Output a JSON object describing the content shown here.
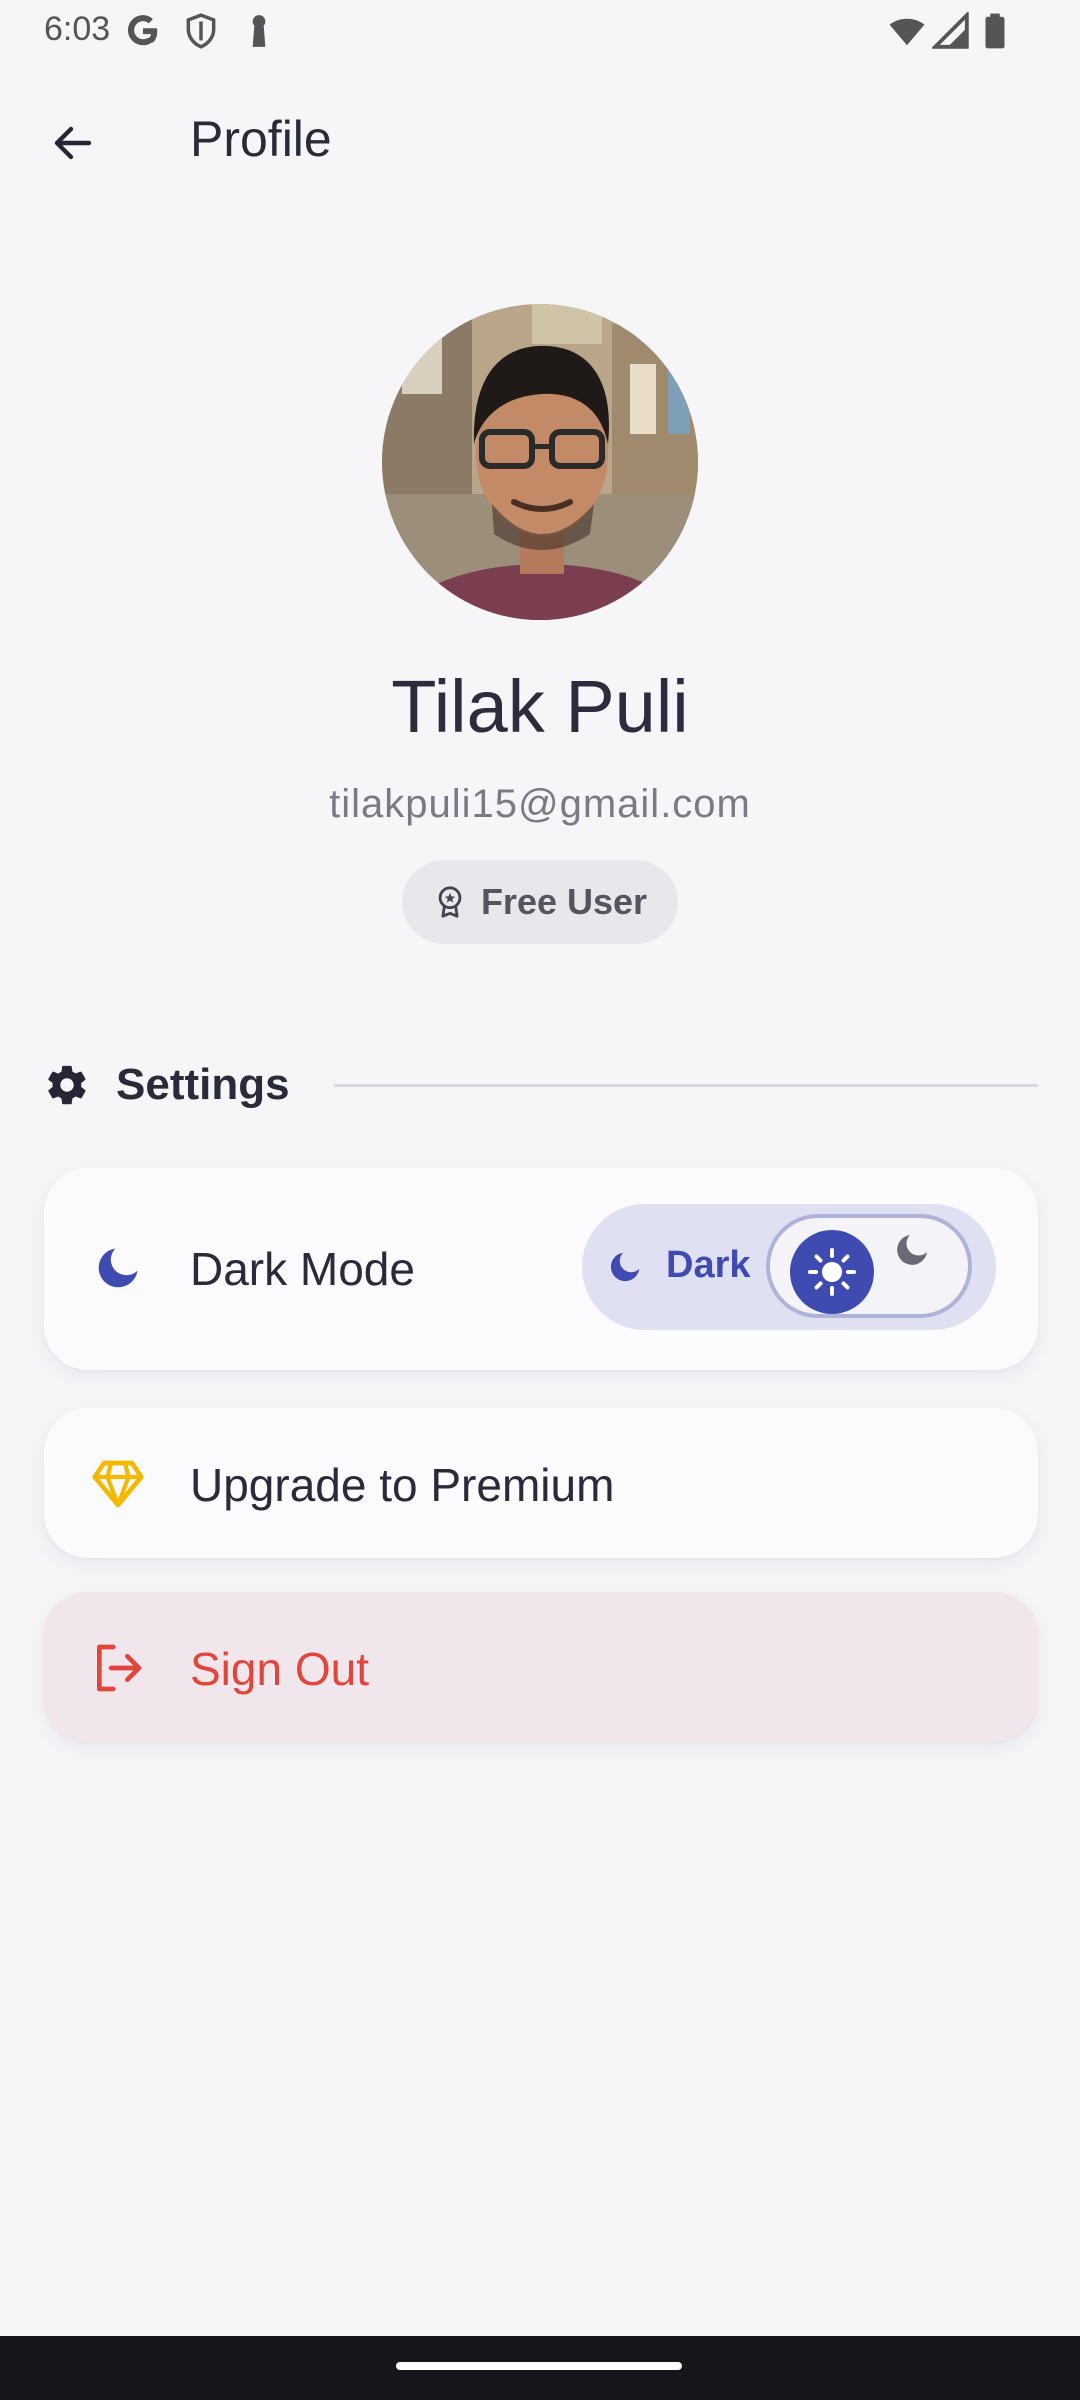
{
  "status_bar": {
    "time": "6:03",
    "left_icons": [
      "google-g-icon",
      "shield-icon",
      "keyhole-icon"
    ],
    "right_icons": [
      "wifi-icon",
      "cell-signal-icon",
      "battery-icon"
    ]
  },
  "app_bar": {
    "back_icon": "arrow-left-icon",
    "title": "Profile"
  },
  "profile": {
    "name": "Tilak Puli",
    "email": "tilakpuli15@gmail.com",
    "plan_badge": {
      "icon": "award-badge-icon",
      "label": "Free User"
    }
  },
  "settings": {
    "icon": "gear-icon",
    "title": "Settings",
    "items": [
      {
        "icon": "moon-icon",
        "label": "Dark Mode",
        "theme_switch": {
          "current_label": "Dark",
          "current_icon": "moon-icon",
          "thumb_icon": "sun-icon",
          "track_icon": "moon-icon"
        }
      },
      {
        "icon": "diamond-icon",
        "label": "Upgrade to Premium"
      },
      {
        "icon": "logout-icon",
        "label": "Sign Out"
      }
    ]
  },
  "colors": {
    "background": "#f6f6f9",
    "accent": "#3f4bb0",
    "premium": "#f5b800",
    "danger": "#e0463c",
    "danger_bg": "#f1e6ec"
  }
}
